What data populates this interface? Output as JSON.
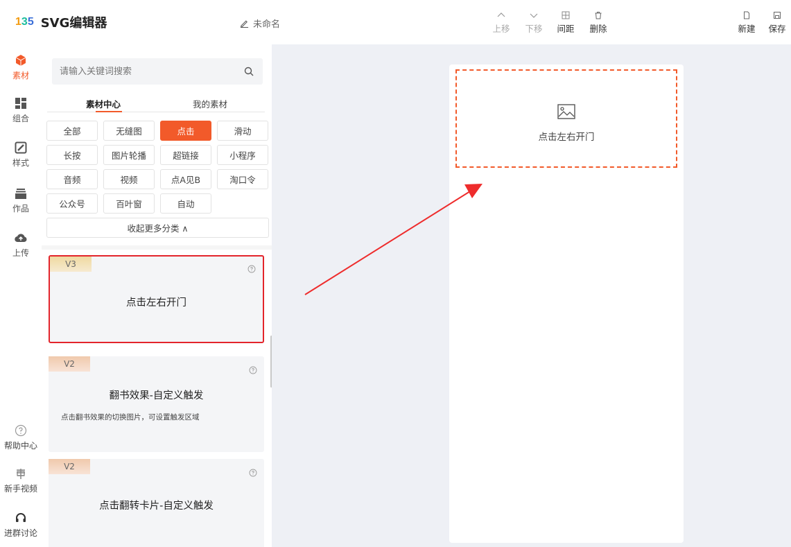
{
  "app": {
    "logo_mark": "135",
    "title": "SVG编辑器",
    "doc_name": "未命名"
  },
  "toolbar": {
    "move_up": "上移",
    "move_down": "下移",
    "spacing": "间距",
    "delete": "删除",
    "new": "新建",
    "save": "保存"
  },
  "rail": {
    "material": "素材",
    "combo": "组合",
    "style": "样式",
    "works": "作品",
    "upload": "上传",
    "help": "帮助中心",
    "tutorial": "新手视频",
    "group": "进群讨论"
  },
  "panel": {
    "search_placeholder": "请输入关键词搜索",
    "tabs": [
      "素材中心",
      "我的素材"
    ],
    "categories": [
      "全部",
      "无缝图",
      "点击",
      "滑动",
      "长按",
      "图片轮播",
      "超链接",
      "小程序",
      "音频",
      "视频",
      "点A见B",
      "淘口令",
      "公众号",
      "百叶窗",
      "自动"
    ],
    "active_category": "点击",
    "collapse_label": "收起更多分类 ∧",
    "cards": [
      {
        "version": "V3",
        "title": "点击左右开门",
        "desc": ""
      },
      {
        "version": "V2",
        "title": "翻书效果-自定义触发",
        "desc": "点击翻书效果的切换图片，可设置触发区域"
      },
      {
        "version": "V2",
        "title": "点击翻转卡片-自定义触发",
        "desc": ""
      }
    ]
  },
  "canvas": {
    "placeholder_label": "点击左右开门"
  },
  "colors": {
    "accent": "#f25a2a",
    "highlight_border": "#e3242b",
    "canvas_bg": "#eef0f5"
  }
}
